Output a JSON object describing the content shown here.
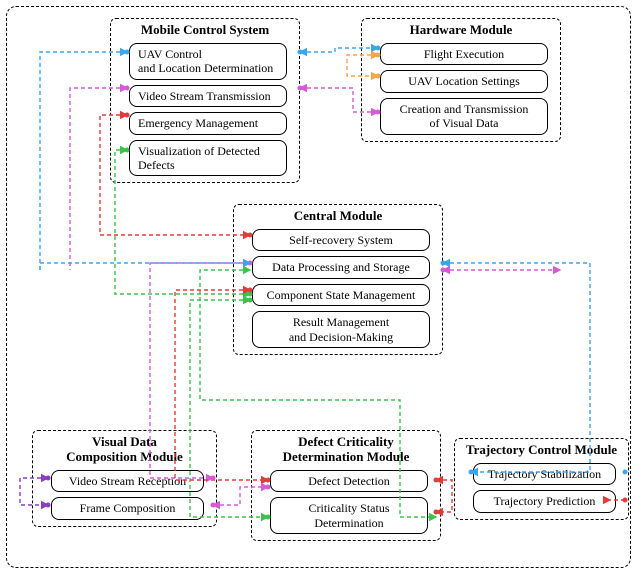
{
  "modules": {
    "mobile": {
      "title": "Mobile Control System",
      "items": [
        "UAV Control\nand Location Determination",
        "Video Stream Transmission",
        "Emergency Management",
        "Visualization of Detected\nDefects"
      ]
    },
    "hardware": {
      "title": "Hardware Module",
      "items": [
        "Flight Execution",
        "UAV Location Settings",
        "Creation and Transmission\nof Visual Data"
      ]
    },
    "central": {
      "title": "Central Module",
      "items": [
        "Self-recovery System",
        "Data Processing and Storage",
        "Component State Management",
        "Result Management\nand Decision-Making"
      ]
    },
    "visual": {
      "title": "Visual Data\nComposition Module",
      "items": [
        "Video Stream Reception",
        "Frame Composition"
      ]
    },
    "defect": {
      "title": "Defect Criticality\nDetermination Module",
      "items": [
        "Defect Detection",
        "Criticality Status\nDetermination"
      ]
    },
    "trajectory": {
      "title": "Trajectory Control Module",
      "items": [
        "Trajectory Stabilization",
        "Trajectory Prediction"
      ]
    }
  },
  "chart_data": {
    "type": "diagram",
    "nodes": [
      {
        "id": "MCS",
        "label": "Mobile Control System",
        "components": [
          "UAV Control and Location Determination",
          "Video Stream Transmission",
          "Emergency Management",
          "Visualization of Detected Defects"
        ]
      },
      {
        "id": "HW",
        "label": "Hardware Module",
        "components": [
          "Flight Execution",
          "UAV Location Settings",
          "Creation and Transmission of Visual Data"
        ]
      },
      {
        "id": "CM",
        "label": "Central Module",
        "components": [
          "Self-recovery System",
          "Data Processing and Storage",
          "Component State Management",
          "Result Management and Decision-Making"
        ]
      },
      {
        "id": "VDC",
        "label": "Visual Data Composition Module",
        "components": [
          "Video Stream Reception",
          "Frame Composition"
        ]
      },
      {
        "id": "DCD",
        "label": "Defect Criticality Determination Module",
        "components": [
          "Defect Detection",
          "Criticality Status Determination"
        ]
      },
      {
        "id": "TC",
        "label": "Trajectory Control Module",
        "components": [
          "Trajectory Stabilization",
          "Trajectory Prediction"
        ]
      }
    ],
    "edges": [
      {
        "from": "MCS.UAV Control",
        "to": "HW.Flight Execution",
        "color": "#3aa6f2",
        "bidir": true
      },
      {
        "from": "HW.Flight Execution",
        "to": "HW.UAV Location Settings",
        "color": "#f5a54a",
        "bidir": true
      },
      {
        "from": "MCS.Video Stream Transmission",
        "to": "HW.Creation and Transmission of Visual Data",
        "color": "#d65ad6",
        "bidir": true
      },
      {
        "from": "MCS.Emergency Management",
        "to": "CM.Self-recovery System",
        "color": "#e23b3b",
        "bidir": true
      },
      {
        "from": "MCS.Visualization of Detected Defects",
        "to": "CM.Data Processing and Storage",
        "color": "#3cc24a",
        "bidir": true
      },
      {
        "from": "CM.Data Processing and Storage",
        "to": "TC.Trajectory Stabilization",
        "color": "#3aa6f2",
        "bidir": true
      },
      {
        "from": "CM.Data Processing and Storage",
        "to": "TC.Trajectory Prediction",
        "color": "#e23b3b",
        "bidir": true
      },
      {
        "from": "CM.Data Processing and Storage",
        "to": "VDC.Video Stream Reception",
        "color": "#d65ad6",
        "bidir": true
      },
      {
        "from": "CM.Data Processing and Storage",
        "to": "DCD.Criticality Status Determination",
        "color": "#3cc24a",
        "bidir": true
      },
      {
        "from": "CM.Component State Management",
        "to": "DCD.Defect Detection",
        "color": "#e23b3b",
        "bidir": true
      },
      {
        "from": "VDC.Video Stream Reception",
        "to": "VDC.Frame Composition",
        "color": "#8a3cc2",
        "bidir": true
      },
      {
        "from": "VDC.Frame Composition",
        "to": "DCD.Defect Detection",
        "color": "#d65ad6",
        "bidir": true
      },
      {
        "from": "DCD.Defect Detection",
        "to": "DCD.Criticality Status Determination",
        "color": "#e23b3b",
        "bidir": true
      }
    ]
  },
  "colors": {
    "blue": "#3aa6f2",
    "orange": "#f5a54a",
    "magenta": "#d65ad6",
    "red": "#e23b3b",
    "green": "#3cc24a",
    "purple": "#8a3cc2"
  }
}
